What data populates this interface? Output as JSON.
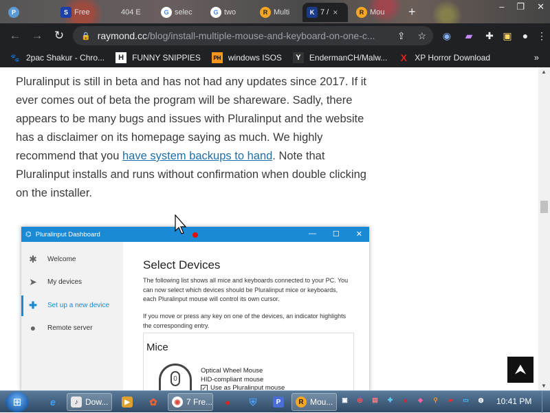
{
  "tabs": [
    {
      "icon": "P",
      "label": "",
      "close": ""
    },
    {
      "icon": "S",
      "label": "Free",
      "close": ""
    },
    {
      "icon": "",
      "label": "404 E",
      "close": ""
    },
    {
      "icon": "G",
      "label": "selec",
      "close": ""
    },
    {
      "icon": "G",
      "label": "two",
      "close": ""
    },
    {
      "icon": "R",
      "label": "Multi",
      "close": ""
    },
    {
      "icon": "K",
      "label": "7 /",
      "close": "×"
    },
    {
      "icon": "R",
      "label": "Mou",
      "close": ""
    }
  ],
  "window": {
    "minimize": "–",
    "maximize": "❐",
    "close": "✕",
    "newtab": "+"
  },
  "toolbar": {
    "back": "←",
    "forward": "→",
    "reload": "↻",
    "lock": "🔒"
  },
  "omnibox": {
    "host": "raymond.cc",
    "path": "/blog/install-multiple-mouse-and-keyboard-on-one-c..."
  },
  "bookmarks": [
    {
      "icon": "🐾",
      "label": "2pac Shakur - Chro..."
    },
    {
      "icon": "H",
      "label": "FUNNY SNIPPIES"
    },
    {
      "icon": "PH",
      "label": "windows ISOS"
    },
    {
      "icon": "Y",
      "label": "EndermanCH/Malw..."
    },
    {
      "icon": "X",
      "label": "XP Horror Download"
    }
  ],
  "bookmarks_more": "»",
  "article": {
    "p1": "Pluralinput is still in beta and has not had any updates since 2017. If it ever comes out of beta the program will be shareware. Sadly, there appears to be many bugs and issues with Pluralinput and the website has a disclaimer on its homepage saying as much. We highly recommend that you ",
    "link": "have system backups to hand",
    "p2": ". Note that Pluralinput installs and runs without confirmation when double clicking on the installer."
  },
  "shot": {
    "title": "Pluralinput Dashboard",
    "win_min": "—",
    "win_max": "☐",
    "win_close": "✕",
    "sidebar": [
      {
        "icon": "✱",
        "label": "Welcome"
      },
      {
        "icon": "➤",
        "label": "My devices"
      },
      {
        "icon": "✚",
        "label": "Set up a new device"
      },
      {
        "icon": "●",
        "label": "Remote server"
      }
    ],
    "heading": "Select Devices",
    "para1": "The following list shows all mice and keyboards connected to your PC. You can now select which devices should be Pluralinput mice or keyboards, each Pluralinput mouse will control its own cursor.",
    "para2": "If you move or press any key on one of the devices, an indicator highlights the corresponding entry.",
    "mice_heading": "Mice",
    "mouse_number": "0",
    "device_name": "Optical Wheel Mouse",
    "device_type": "HID-compliant mouse",
    "checkbox_mark": "✓",
    "checkbox_label": "Use as Pluralinput mouse"
  },
  "back_to_top": "⮝",
  "scroll": {
    "up": "▲",
    "down": "▼"
  },
  "taskbar": {
    "start": "⊞",
    "apps": [
      {
        "icon": "e",
        "label": ""
      },
      {
        "icon": "♪",
        "label": "Dow..."
      },
      {
        "icon": "▶",
        "label": ""
      },
      {
        "icon": "✿",
        "label": ""
      },
      {
        "icon": "◉",
        "label": "7 Fre..."
      },
      {
        "icon": "●",
        "label": ""
      },
      {
        "icon": "⛨",
        "label": ""
      },
      {
        "icon": "P",
        "label": ""
      },
      {
        "icon": "R",
        "label": "Mou..."
      }
    ],
    "tray": [
      "▣",
      "◎",
      "▤",
      "✚",
      "V",
      "◆",
      "⚲",
      "▰",
      "▭",
      "◍"
    ],
    "clock": "10:41 PM"
  }
}
